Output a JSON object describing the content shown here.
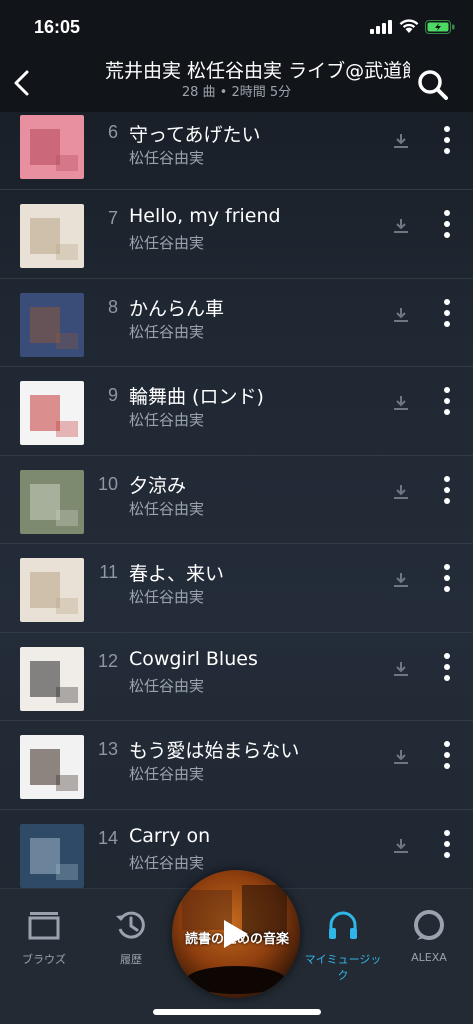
{
  "status": {
    "time": "16:05"
  },
  "header": {
    "title": "荒井由実 松任谷由実 ライブ@武道館",
    "subtitle": "28 曲 • 2時間 5分"
  },
  "tracks": [
    {
      "num": "6",
      "title": "守ってあげたい",
      "artist": "松任谷由実",
      "art": [
        "#e88fa0",
        "#b34a5c"
      ]
    },
    {
      "num": "7",
      "title": "Hello, my friend",
      "artist": "松任谷由実",
      "art": [
        "#e9e1d6",
        "#b9a58a"
      ]
    },
    {
      "num": "8",
      "title": "かんらん車",
      "artist": "松任谷由実",
      "art": [
        "#3a4c78",
        "#8a5a3c"
      ]
    },
    {
      "num": "9",
      "title": "輪舞曲 (ロンド)",
      "artist": "松任谷由実",
      "art": [
        "#f4f4f4",
        "#c73a3a"
      ]
    },
    {
      "num": "10",
      "title": "夕涼み",
      "artist": "松任谷由実",
      "art": [
        "#7e8a70",
        "#c9cfc0"
      ]
    },
    {
      "num": "11",
      "title": "春よ、来い",
      "artist": "松任谷由実",
      "art": [
        "#e9e1d6",
        "#b9a58a"
      ]
    },
    {
      "num": "12",
      "title": "Cowgirl Blues",
      "artist": "松任谷由実",
      "art": [
        "#f0ece8",
        "#2a2a2a"
      ]
    },
    {
      "num": "13",
      "title": "もう愛は始まらない",
      "artist": "松任谷由実",
      "art": [
        "#f2f2f2",
        "#3a2a22"
      ]
    },
    {
      "num": "14",
      "title": "Carry on",
      "artist": "松任谷由実",
      "art": [
        "#2e4a66",
        "#9fb4c6"
      ]
    }
  ],
  "tabs": {
    "browse": "ブラウズ",
    "history": "履歴",
    "my_music": "マイミュージック",
    "alexa": "ALEXA"
  },
  "now_playing": {
    "title": "読書のための音楽"
  },
  "colors": {
    "accent": "#2fb6e8",
    "battery": "#4cd964"
  }
}
